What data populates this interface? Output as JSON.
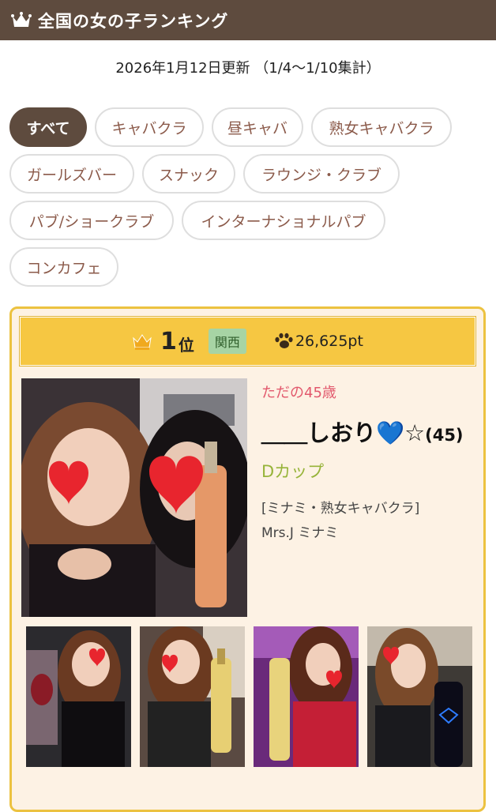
{
  "header": {
    "title": "全国の女の子ランキング",
    "icon": "crown-icon"
  },
  "updated": "2026年1月12日更新 （1/4〜1/10集計）",
  "tabs": [
    {
      "label": "すべて",
      "active": true
    },
    {
      "label": "キャバクラ",
      "active": false
    },
    {
      "label": "昼キャバ",
      "active": false
    },
    {
      "label": "熟女キャバクラ",
      "active": false
    },
    {
      "label": "ガールズバー",
      "active": false
    },
    {
      "label": "スナック",
      "active": false
    },
    {
      "label": "ラウンジ・クラブ",
      "active": false
    },
    {
      "label": "パブ/ショークラブ",
      "active": false
    },
    {
      "label": "インターナショナルパブ",
      "active": false
    },
    {
      "label": "コンカフェ",
      "active": false
    }
  ],
  "entry": {
    "rank": "1",
    "rank_suffix": "位",
    "region": "関西",
    "points": "26,625pt",
    "catchphrase": "ただの45歳",
    "name": "＿＿しおり💙☆",
    "age": "(45)",
    "cup": "Dカップ",
    "shop_line1": "[ミナミ・熟女キャバクラ]",
    "shop_line2": "Mrs.J ミナミ"
  },
  "colors": {
    "header_bg": "#5e4b3e",
    "card_border": "#ecc240",
    "card_bg": "#fdf2e4",
    "rank_bar": "#f6c742",
    "region_badge": "#a7d4a4",
    "catch_text": "#e2586c",
    "cup_text": "#97b43a"
  }
}
